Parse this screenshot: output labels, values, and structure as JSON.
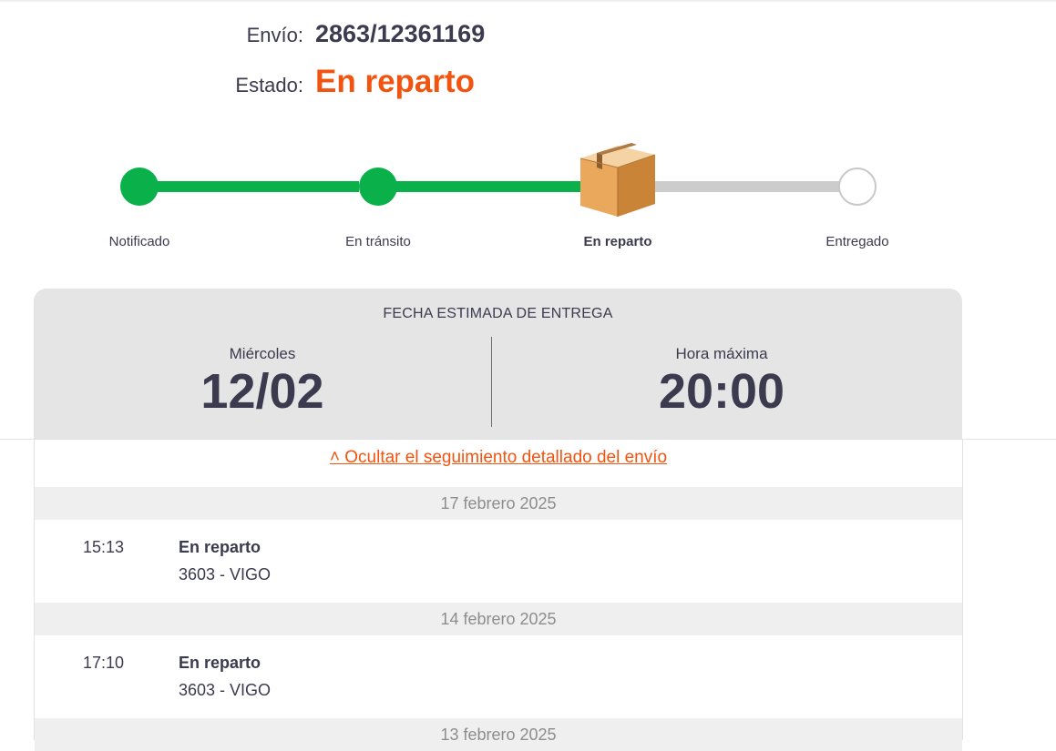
{
  "shipment": {
    "envio_label": "Envío:",
    "envio_value": "2863/12361169",
    "estado_label": "Estado:",
    "estado_value": "En reparto",
    "accent_color": "#f25410"
  },
  "tracker": {
    "steps": [
      {
        "label": "Notificado",
        "state": "done"
      },
      {
        "label": "En tránsito",
        "state": "done"
      },
      {
        "label": "En reparto",
        "state": "current",
        "icon": "package-box-icon"
      },
      {
        "label": "Entregado",
        "state": "pending"
      }
    ],
    "done_color": "#0ab14a",
    "pending_color": "#cccccc"
  },
  "estimate": {
    "title": "FECHA ESTIMADA DE ENTREGA",
    "day_label": "Miércoles",
    "date": "12/02",
    "hour_label": "Hora máxima",
    "hour": "20:00"
  },
  "detail": {
    "toggle_label": "˄ Ocultar el seguimiento detallado del envío",
    "groups": [
      {
        "date": "17 febrero 2025",
        "events": [
          {
            "time": "15:13",
            "status": "En reparto",
            "place": "3603 - VIGO"
          }
        ]
      },
      {
        "date": "14 febrero 2025",
        "events": [
          {
            "time": "17:10",
            "status": "En reparto",
            "place": "3603 - VIGO"
          }
        ]
      },
      {
        "date": "13 febrero 2025",
        "events": []
      }
    ]
  }
}
